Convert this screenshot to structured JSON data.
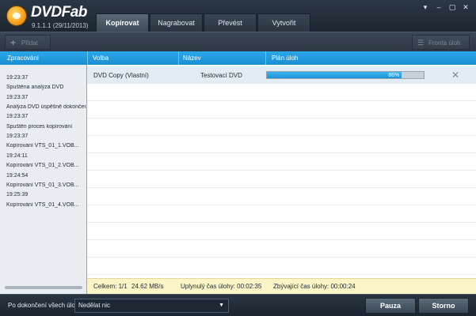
{
  "app": {
    "brand": "DVDFab",
    "version": "9.1.1.1 (29/11/2013)"
  },
  "tabs": [
    {
      "label": "Kopírovat",
      "active": true
    },
    {
      "label": "Nagrabovat",
      "active": false
    },
    {
      "label": "Převést",
      "active": false
    },
    {
      "label": "Vytvořit",
      "active": false
    }
  ],
  "toolbar": {
    "add_label": "Přidat",
    "queue_label": "Fronta úloh"
  },
  "columns": {
    "log": "Zpracování",
    "option": "Volba",
    "name": "Název",
    "plan": "Plán úloh"
  },
  "log": [
    "19:23:37",
    "Spuštěna analýza DVD",
    "19:23:37",
    "Analýza DVD úspěšně dokončena",
    "19:23:37",
    "Spuštěn proces kopírování",
    "19:23:37",
    "Kopírování VTS_01_1.VOB...",
    "19:24:11",
    "Kopírování VTS_01_2.VOB...",
    "19:24:54",
    "Kopírování VTS_01_3.VOB...",
    "19:25:39",
    "Kopírování VTS_01_4.VOB..."
  ],
  "task": {
    "option": "DVD Copy (Vlastní)",
    "name": "Testovací DVD",
    "progress_text": "86%",
    "progress": 86
  },
  "summary": {
    "total": "Celkem: 1/1",
    "speed": "24.62 MB/s",
    "elapsed": "Uplynulý čas úlohy: 00:02:35",
    "remaining": "Zbývající čas úlohy: 00:00:24"
  },
  "bottom": {
    "after_label": "Po dokončení všech úloh:",
    "after_value": "Nedělat nic",
    "pause_label": "Pauza",
    "cancel_label": "Storno"
  },
  "colors": {
    "accent": "#1a8fd1",
    "progress": "#2ea6ea",
    "summary_bg": "#fbf4c7"
  }
}
